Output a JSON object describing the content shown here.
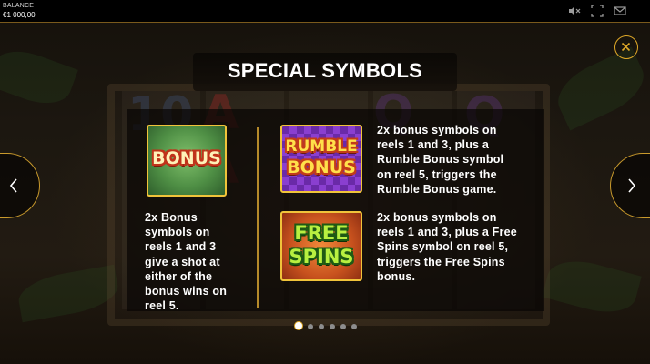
{
  "balance": {
    "label": "BALANCE",
    "value": "€1 000,00"
  },
  "top_icons": [
    "mute-icon",
    "fullscreen-icon",
    "message-icon"
  ],
  "panel": {
    "title": "SPECIAL SYMBOLS",
    "symbols": [
      {
        "name": "bonus",
        "art_text": [
          "BONUS"
        ],
        "description": "2x Bonus\nsymbols on\nreels 1 and 3\ngive a shot at\neither of the\nbonus wins on\nreel 5."
      },
      {
        "name": "rumble-bonus",
        "art_text": [
          "RUMBLE",
          "BONUS"
        ],
        "description": "2x bonus symbols on\nreels 1 and 3, plus a\nRumble Bonus symbol\non reel 5, triggers the\nRumble Bonus game."
      },
      {
        "name": "free-spins",
        "art_text": [
          "FREE",
          "SPINS"
        ],
        "description": "2x bonus symbols on\nreels 1 and 3, plus a Free\nSpins symbol on reel 5,\ntriggers the Free Spins\nbonus."
      }
    ]
  },
  "pagination": {
    "total_pages": 6,
    "current_page": 1
  },
  "colors": {
    "accent": "#e0a928",
    "divider": "#b58a2a",
    "top_bar": "#000000"
  }
}
